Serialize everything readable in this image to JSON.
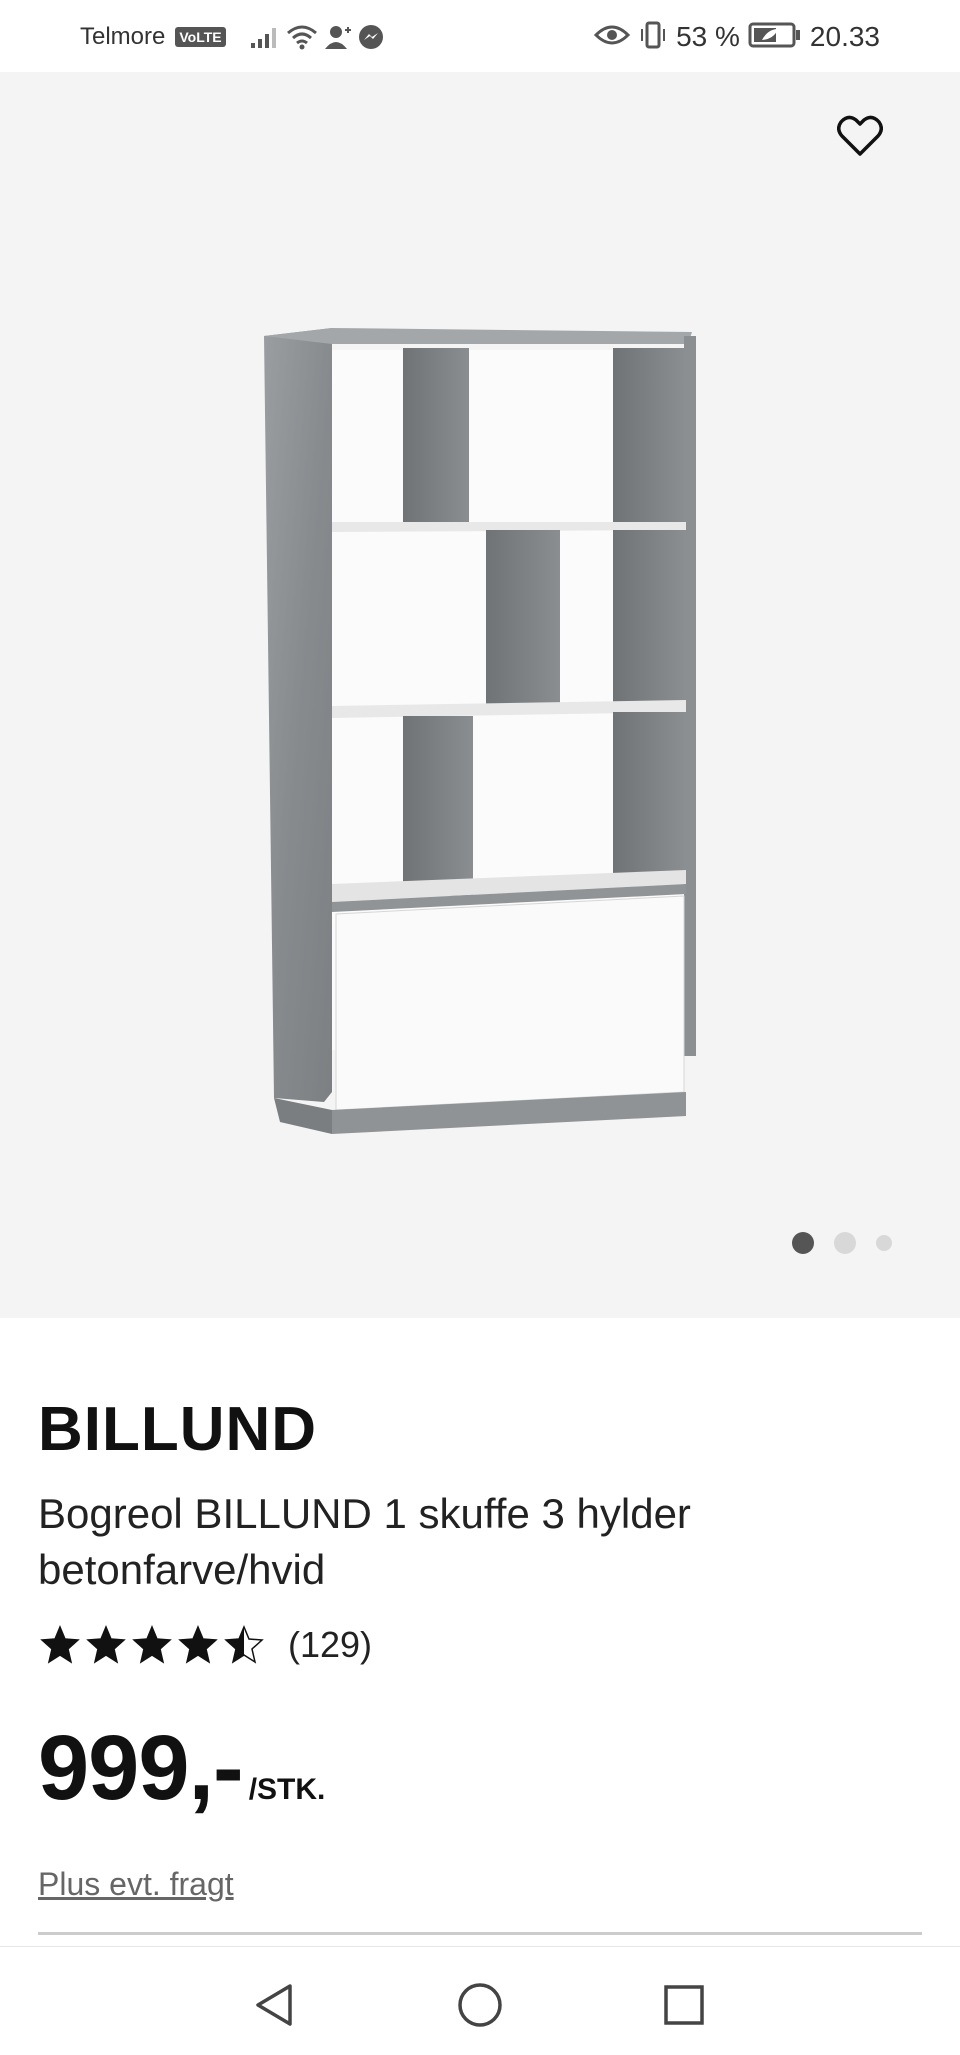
{
  "status_bar": {
    "carrier": "Telmore",
    "volte": "VoLTE",
    "battery": "53 %",
    "time": "20.33",
    "icons": [
      "signal-icon",
      "wifi-icon",
      "user-add-icon",
      "messenger-icon",
      "eye-icon",
      "vibrate-icon",
      "battery-icon"
    ]
  },
  "gallery": {
    "favorite_icon": "heart-outline-icon",
    "image_alt": "Bogreol BILLUND",
    "slides": 3,
    "active_slide": 1
  },
  "product": {
    "brand": "BILLUND",
    "name": "Bogreol BILLUND 1 skuffe 3 hylder betonfarve/hvid",
    "rating": 4.5,
    "rating_max": 5,
    "review_count": "(129)",
    "price": "999,-",
    "unit": "/STK.",
    "shipping": "Plus evt. fragt"
  },
  "nav_bar": {
    "buttons": [
      "back-triangle-icon",
      "home-circle-icon",
      "recents-square-icon"
    ]
  },
  "colors": {
    "gallery_bg": "#f4f4f4",
    "text": "#111111",
    "muted": "#666666",
    "concrete": "#8f9396",
    "white_panel": "#fbfbfb"
  }
}
